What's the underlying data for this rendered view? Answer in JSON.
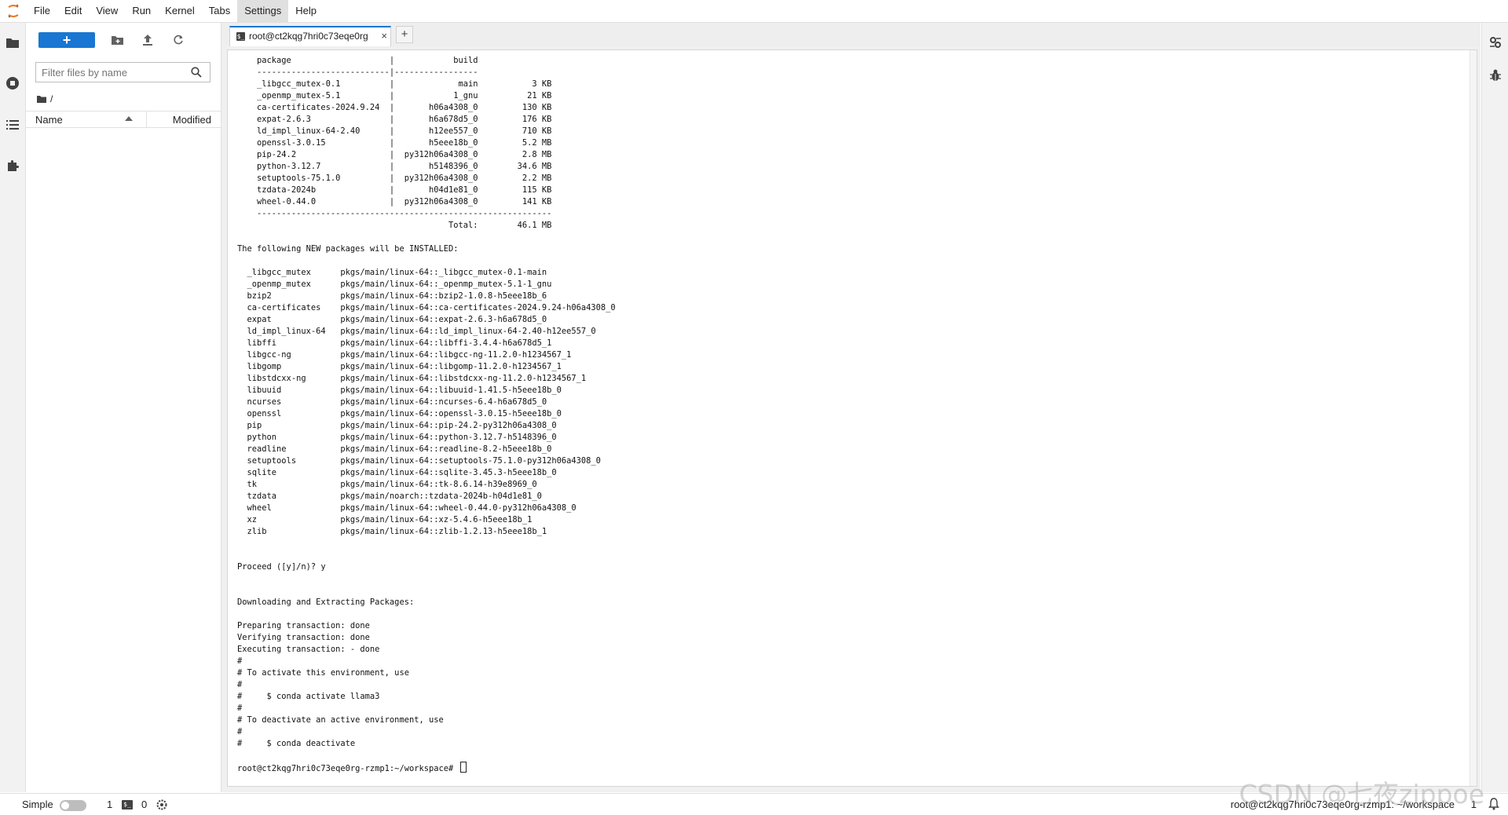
{
  "menubar": {
    "items": [
      "File",
      "Edit",
      "View",
      "Run",
      "Kernel",
      "Tabs",
      "Settings",
      "Help"
    ],
    "active": "Settings"
  },
  "filebrowser": {
    "new_button_label": "+",
    "filter_placeholder": "Filter files by name",
    "breadcrumb": "/",
    "col_name": "Name",
    "col_modified": "Modified"
  },
  "tab": {
    "icon": "$_",
    "label": "root@ct2kqg7hri0c73eqe0rg",
    "close": "×",
    "new_tab": "+"
  },
  "terminal": {
    "output": "    package                    |            build\n    ---------------------------|-----------------\n    _libgcc_mutex-0.1          |             main           3 KB\n    _openmp_mutex-5.1          |            1_gnu          21 KB\n    ca-certificates-2024.9.24  |       h06a4308_0         130 KB\n    expat-2.6.3                |       h6a678d5_0         176 KB\n    ld_impl_linux-64-2.40      |       h12ee557_0         710 KB\n    openssl-3.0.15             |       h5eee18b_0         5.2 MB\n    pip-24.2                   |  py312h06a4308_0         2.8 MB\n    python-3.12.7              |       h5148396_0        34.6 MB\n    setuptools-75.1.0          |  py312h06a4308_0         2.2 MB\n    tzdata-2024b               |       h04d1e81_0         115 KB\n    wheel-0.44.0               |  py312h06a4308_0         141 KB\n    ------------------------------------------------------------\n                                           Total:        46.1 MB\n\nThe following NEW packages will be INSTALLED:\n\n  _libgcc_mutex      pkgs/main/linux-64::_libgcc_mutex-0.1-main\n  _openmp_mutex      pkgs/main/linux-64::_openmp_mutex-5.1-1_gnu\n  bzip2              pkgs/main/linux-64::bzip2-1.0.8-h5eee18b_6\n  ca-certificates    pkgs/main/linux-64::ca-certificates-2024.9.24-h06a4308_0\n  expat              pkgs/main/linux-64::expat-2.6.3-h6a678d5_0\n  ld_impl_linux-64   pkgs/main/linux-64::ld_impl_linux-64-2.40-h12ee557_0\n  libffi             pkgs/main/linux-64::libffi-3.4.4-h6a678d5_1\n  libgcc-ng          pkgs/main/linux-64::libgcc-ng-11.2.0-h1234567_1\n  libgomp            pkgs/main/linux-64::libgomp-11.2.0-h1234567_1\n  libstdcxx-ng       pkgs/main/linux-64::libstdcxx-ng-11.2.0-h1234567_1\n  libuuid            pkgs/main/linux-64::libuuid-1.41.5-h5eee18b_0\n  ncurses            pkgs/main/linux-64::ncurses-6.4-h6a678d5_0\n  openssl            pkgs/main/linux-64::openssl-3.0.15-h5eee18b_0\n  pip                pkgs/main/linux-64::pip-24.2-py312h06a4308_0\n  python             pkgs/main/linux-64::python-3.12.7-h5148396_0\n  readline           pkgs/main/linux-64::readline-8.2-h5eee18b_0\n  setuptools         pkgs/main/linux-64::setuptools-75.1.0-py312h06a4308_0\n  sqlite             pkgs/main/linux-64::sqlite-3.45.3-h5eee18b_0\n  tk                 pkgs/main/linux-64::tk-8.6.14-h39e8969_0\n  tzdata             pkgs/main/noarch::tzdata-2024b-h04d1e81_0\n  wheel              pkgs/main/linux-64::wheel-0.44.0-py312h06a4308_0\n  xz                 pkgs/main/linux-64::xz-5.4.6-h5eee18b_1\n  zlib               pkgs/main/linux-64::zlib-1.2.13-h5eee18b_1\n\n\nProceed ([y]/n)? y\n\n\nDownloading and Extracting Packages:\n\nPreparing transaction: done\nVerifying transaction: done\nExecuting transaction: - done\n#\n# To activate this environment, use\n#\n#     $ conda activate llama3\n#\n# To deactivate an active environment, use\n#\n#     $ conda deactivate\n\n",
    "prompt": "root@ct2kqg7hri0c73eqe0rg-rzmp1:~/workspace# "
  },
  "statusbar": {
    "simple_label": "Simple",
    "kernels_count": "1",
    "terminal_icon": "$_",
    "terminals_count": "0",
    "path": "root@ct2kqg7hri0c73eqe0rg-rzmp1: ~/workspace",
    "line": "1"
  },
  "watermark": "CSDN @七夜zippoe",
  "colors": {
    "accent": "#1976d2",
    "logo": "#f37626"
  },
  "icons": {
    "activity": [
      "folder-icon",
      "running-icon",
      "toc-icon",
      "extension-icon"
    ],
    "toolbar": [
      "new-folder-icon",
      "upload-icon",
      "refresh-icon"
    ],
    "right": [
      "property-inspector-icon",
      "debugger-icon"
    ]
  }
}
